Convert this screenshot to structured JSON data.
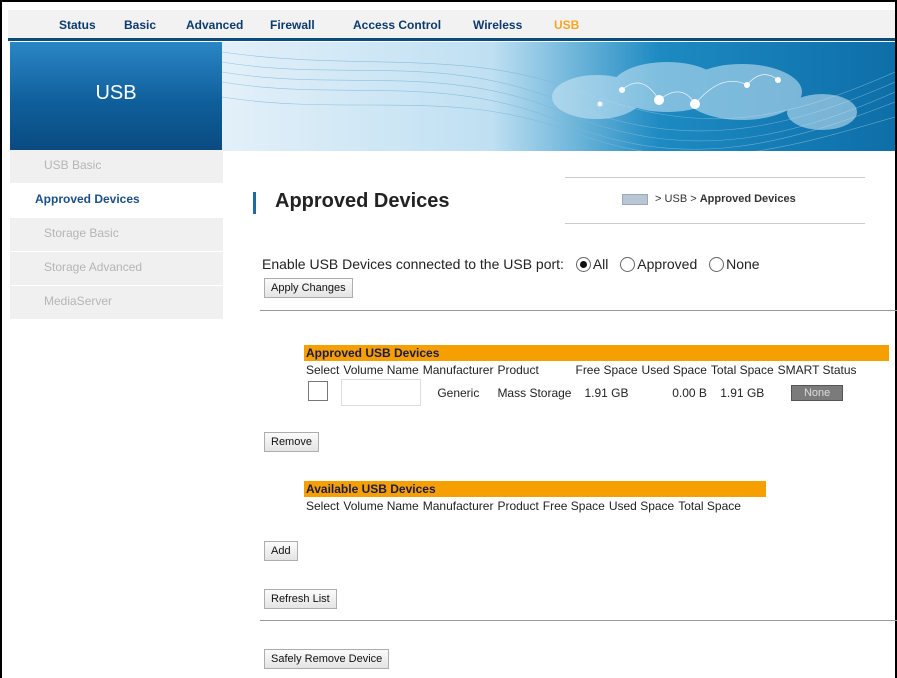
{
  "topnav": {
    "items": [
      {
        "label": "Status"
      },
      {
        "label": "Basic"
      },
      {
        "label": "Advanced"
      },
      {
        "label": "Firewall"
      },
      {
        "label": "Access Control"
      },
      {
        "label": "Wireless"
      },
      {
        "label": "USB"
      }
    ],
    "active": "USB"
  },
  "banner": {
    "section_title": "USB"
  },
  "sidebar": {
    "items": [
      {
        "label": "USB Basic"
      },
      {
        "label": "Approved Devices"
      },
      {
        "label": "Storage Basic"
      },
      {
        "label": "Storage Advanced"
      },
      {
        "label": "MediaServer"
      }
    ],
    "active": "Approved Devices"
  },
  "page": {
    "title": "Approved Devices",
    "breadcrumb": {
      "sep1": " > USB > ",
      "current": "Approved Devices"
    }
  },
  "enable": {
    "label": "Enable USB Devices connected to the USB port:",
    "options": [
      {
        "label": "All",
        "selected": true
      },
      {
        "label": "Approved",
        "selected": false
      },
      {
        "label": "None",
        "selected": false
      }
    ]
  },
  "buttons": {
    "apply": "Apply Changes",
    "remove": "Remove",
    "add": "Add",
    "refresh": "Refresh List",
    "safely_remove": "Safely Remove Device"
  },
  "approved_table": {
    "heading": "Approved USB Devices",
    "columns": [
      "Select",
      "Volume Name",
      "Manufacturer",
      "Product",
      "Free Space",
      "Used Space",
      "Total Space",
      "SMART Status"
    ],
    "rows": [
      {
        "volume_name": "",
        "manufacturer": "Generic",
        "product": "Mass Storage",
        "free_space": "1.91 GB",
        "used_space": "0.00 B",
        "total_space": "1.91 GB",
        "smart_status": "None"
      }
    ]
  },
  "available_table": {
    "heading": "Available USB Devices",
    "columns": [
      "Select",
      "Volume Name",
      "Manufacturer",
      "Product",
      "Free Space",
      "Used Space",
      "Total Space"
    ]
  },
  "colors": {
    "accent": "#f5a000",
    "nav_text": "#0c3a6e",
    "active_nav": "#f5a623",
    "banner_blue": "#0f5f9c"
  }
}
